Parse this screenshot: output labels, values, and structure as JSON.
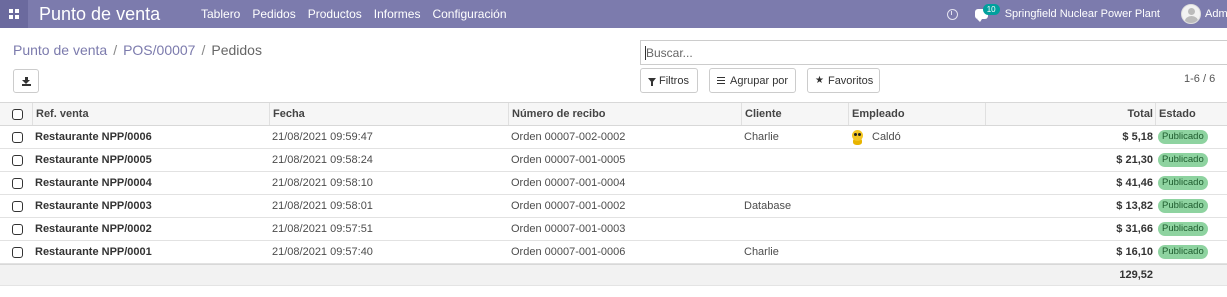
{
  "app": {
    "title": "Punto de venta"
  },
  "menu": [
    "Tablero",
    "Pedidos",
    "Productos",
    "Informes",
    "Configuración"
  ],
  "navbar": {
    "chat_count": "10",
    "company": "Springfield Nuclear Power Plant",
    "user": "Adm"
  },
  "breadcrumb": {
    "item1": "Punto de venta",
    "item2": "POS/00007",
    "current": "Pedidos",
    "separator": "/"
  },
  "search": {
    "placeholder": "Buscar..."
  },
  "filters": {
    "filters_label": "Filtros",
    "group_label": "Agrupar por",
    "favorites_label": "Favoritos"
  },
  "pager": "1-6 / 6",
  "table": {
    "headers": {
      "ref": "Ref. venta",
      "fecha": "Fecha",
      "recibo": "Número de recibo",
      "cliente": "Cliente",
      "empleado": "Empleado",
      "total": "Total",
      "estado": "Estado"
    },
    "rows": [
      {
        "ref": "Restaurante NPP/0006",
        "fecha": "21/08/2021 09:59:47",
        "recibo": "Orden 00007-002-0002",
        "cliente": "Charlie",
        "empleado": "Caldó",
        "total": "$ 5,18",
        "estado": "Publicado"
      },
      {
        "ref": "Restaurante NPP/0005",
        "fecha": "21/08/2021 09:58:24",
        "recibo": "Orden 00007-001-0005",
        "cliente": "",
        "empleado": "",
        "total": "$ 21,30",
        "estado": "Publicado"
      },
      {
        "ref": "Restaurante NPP/0004",
        "fecha": "21/08/2021 09:58:10",
        "recibo": "Orden 00007-001-0004",
        "cliente": "",
        "empleado": "",
        "total": "$ 41,46",
        "estado": "Publicado"
      },
      {
        "ref": "Restaurante NPP/0003",
        "fecha": "21/08/2021 09:58:01",
        "recibo": "Orden 00007-001-0002",
        "cliente": "Database",
        "empleado": "",
        "total": "$ 13,82",
        "estado": "Publicado"
      },
      {
        "ref": "Restaurante NPP/0002",
        "fecha": "21/08/2021 09:57:51",
        "recibo": "Orden 00007-001-0003",
        "cliente": "",
        "empleado": "",
        "total": "$ 31,66",
        "estado": "Publicado"
      },
      {
        "ref": "Restaurante NPP/0001",
        "fecha": "21/08/2021 09:57:40",
        "recibo": "Orden 00007-001-0006",
        "cliente": "Charlie",
        "empleado": "",
        "total": "$ 16,10",
        "estado": "Publicado"
      }
    ],
    "footer_total": "129,52"
  },
  "colors": {
    "navbar": "#7c7bad",
    "accent": "#00a09d",
    "badge": "#8ed3a0"
  },
  "icons": {
    "apps": "apps-grid-icon",
    "clock": "clock-icon",
    "chat": "chat-icon",
    "download": "download-icon",
    "filter": "funnel-icon",
    "group": "list-icon",
    "favorites": "star-icon"
  }
}
